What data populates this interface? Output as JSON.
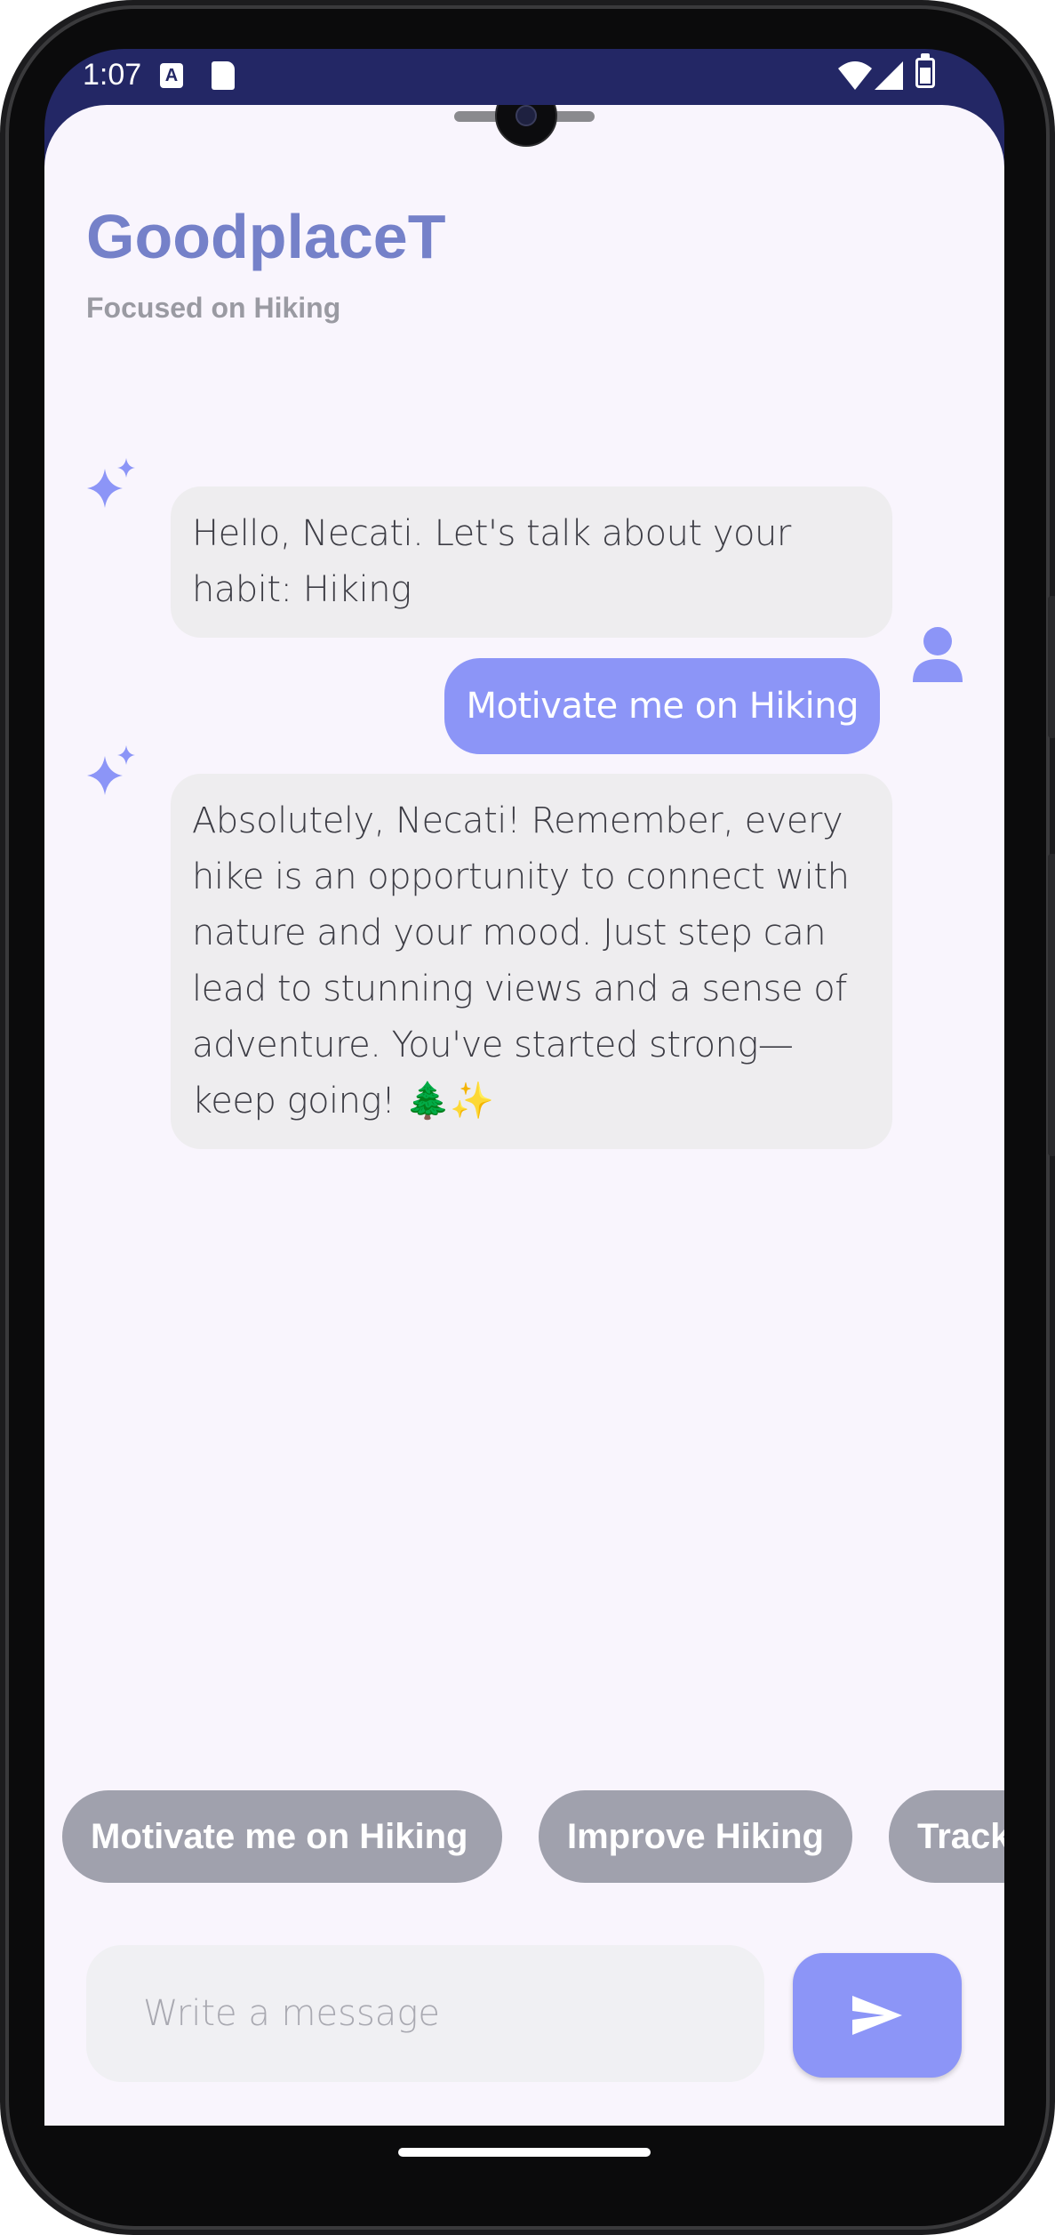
{
  "status_bar": {
    "time": "1:07",
    "a_icon_label": "A"
  },
  "header": {
    "title": "GoodplaceT",
    "subtitle": "Focused on Hiking"
  },
  "messages": [
    {
      "sender": "ai",
      "text": "Hello, Necati. Let's talk about your habit: Hiking"
    },
    {
      "sender": "user",
      "text": "Motivate me on Hiking"
    },
    {
      "sender": "ai",
      "text": "Absolutely, Necati! Remember, every hike is an opportunity to connect with nature and your mood. Just step can lead to stunning views and a sense of adventure. You've started strong—keep going! 🌲✨"
    }
  ],
  "suggestions": [
    "Motivate me on Hiking",
    "Improve Hiking",
    "Track"
  ],
  "composer": {
    "placeholder": "Write a message"
  },
  "colors": {
    "accent": "#8c95f7",
    "title": "#7581c9",
    "chip": "#a0a1ad",
    "status_bar": "#232765"
  },
  "icons": {
    "ai": "sparkle-icon",
    "user": "person-icon",
    "send": "send-icon"
  }
}
